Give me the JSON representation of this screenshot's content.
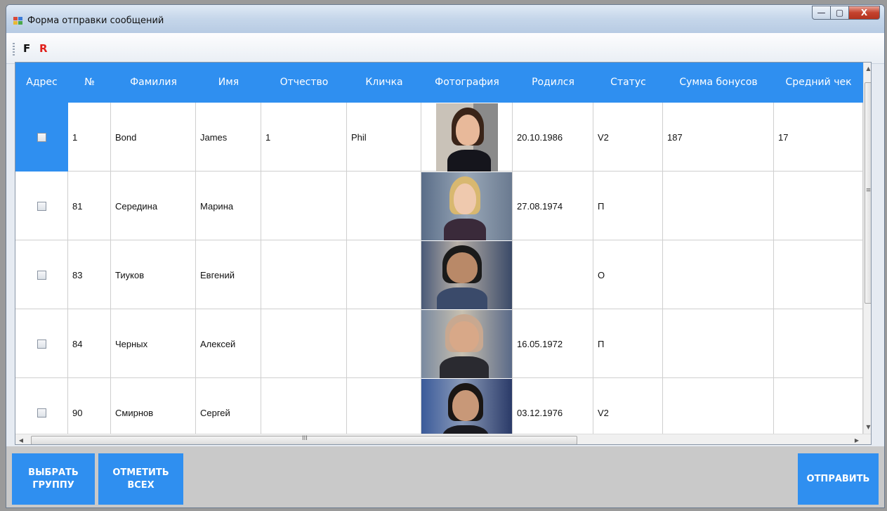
{
  "window": {
    "title": "Форма отправки сообщений",
    "controls": {
      "minimize": "—",
      "maximize": "▢",
      "close": "X"
    }
  },
  "toolbar": {
    "f_label": "F",
    "r_label": "R"
  },
  "grid": {
    "columns": [
      "Адрес",
      "№",
      "Фамилия",
      "Имя",
      "Отчество",
      "Кличка",
      "Фотография",
      "Родился",
      "Статус",
      "Сумма бонусов",
      "Средний чек"
    ],
    "rows": [
      {
        "num": "1",
        "last": "Bond",
        "first": "James",
        "middle": "1",
        "nick": "Phil",
        "born": "20.10.1986",
        "status": "V2",
        "bonus": "187",
        "avg": "17",
        "selected": true
      },
      {
        "num": "81",
        "last": "Середина",
        "first": "Марина",
        "middle": "",
        "nick": "",
        "born": "27.08.1974",
        "status": "П",
        "bonus": "",
        "avg": "",
        "selected": false
      },
      {
        "num": "83",
        "last": "Тиуков",
        "first": "Евгений",
        "middle": "",
        "nick": "",
        "born": "",
        "status": "О",
        "bonus": "",
        "avg": "",
        "selected": false
      },
      {
        "num": "84",
        "last": "Черных",
        "first": "Алексей",
        "middle": "",
        "nick": "",
        "born": "16.05.1972",
        "status": "П",
        "bonus": "",
        "avg": "",
        "selected": false
      },
      {
        "num": "90",
        "last": "Смирнов",
        "first": "Сергей",
        "middle": "",
        "nick": "",
        "born": "03.12.1976",
        "status": "V2",
        "bonus": "",
        "avg": "",
        "selected": false
      }
    ],
    "scrollbars": {
      "up": "▲",
      "down": "▼",
      "left": "◀",
      "right": "▶",
      "v_grip": "≡",
      "h_grip": "III"
    }
  },
  "buttons": {
    "select_group": "ВЫБРАТЬ ГРУППУ",
    "mark_all": "ОТМЕТИТЬ ВСЕХ",
    "send": "ОТПРАВИТЬ"
  },
  "colors": {
    "accent": "#2f8ff0",
    "header_text": "#ffffff",
    "r_color": "#e0201c"
  }
}
